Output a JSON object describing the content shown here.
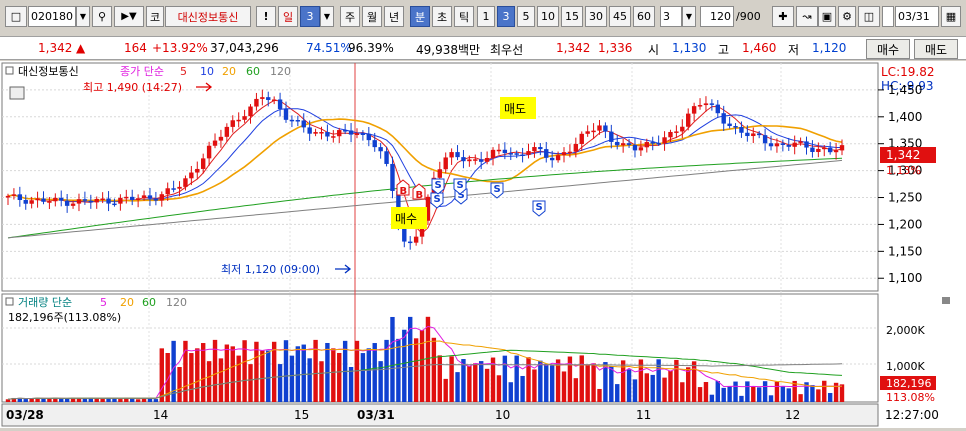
{
  "toolbar": {
    "code": "020180",
    "market_tag": "코",
    "stock_name": "대신정보통신",
    "bang_label": "!",
    "period_day": "일",
    "period_num": "3",
    "period_week": "주",
    "period_month": "월",
    "period_year": "년",
    "period_min": "분",
    "period_sec": "초",
    "period_tick": "틱",
    "intervals": [
      "1",
      "3",
      "5",
      "10",
      "15",
      "30",
      "45",
      "60"
    ],
    "count_sel": "3",
    "view_count": "120",
    "view_total": "/900",
    "date": "03/31"
  },
  "ticker": {
    "price": "1,342",
    "arrow": "▲",
    "change": "164",
    "change_pct": "+13.92%",
    "volume": "37,043,296",
    "pct1": "74.51%",
    "pct2": "96.39%",
    "amount": "49,938백만",
    "best_label": "최우선",
    "best_ask": "1,342",
    "best_bid": "1,336",
    "open_label": "시",
    "open": "1,130",
    "high_label": "고",
    "high": "1,460",
    "low_label": "저",
    "low": "1,120",
    "buy_btn": "매수",
    "sell_btn": "매도"
  },
  "chart_data": {
    "type": "candlestick",
    "price_panel": {
      "name_tag": "대신정보통신",
      "legend_prefix": "종가 단순",
      "ma_periods": [
        "5",
        "10",
        "20",
        "60",
        "120"
      ],
      "ma_colors": [
        "#e02020",
        "#2040e0",
        "#f0a000",
        "#20a020",
        "#808080"
      ],
      "y_ticks": [
        1450,
        1400,
        1350,
        1300,
        1250,
        1200,
        1150,
        1100
      ],
      "ylim": [
        1080,
        1470
      ],
      "lc_label": "LC:19.82",
      "hc_label": "HC:-9.93",
      "current_price": "1,342",
      "current_pct": "1.13%",
      "high_annotation": "최고 1,490 (14:27)",
      "low_annotation": "최저 1,120 (09:00)",
      "buy_badge": "매수",
      "sell_badge": "매도",
      "signal_s": "S",
      "signal_b": "B"
    },
    "volume_panel": {
      "legend_prefix": "거래량 단순",
      "ma_periods": [
        "5",
        "20",
        "60",
        "120"
      ],
      "ma_colors": [
        "#e020e0",
        "#f0a000",
        "#20a020",
        "#808080"
      ],
      "current_label": "182,196주(113.08%)",
      "y_ticks": [
        "2,000K",
        "1,000K"
      ],
      "current_value": "182,196",
      "current_pct": "113.08%"
    },
    "x_labels": [
      "03/28",
      "14",
      "15",
      "03/31",
      "10",
      "11",
      "12"
    ],
    "time_label": "12:27:00"
  }
}
